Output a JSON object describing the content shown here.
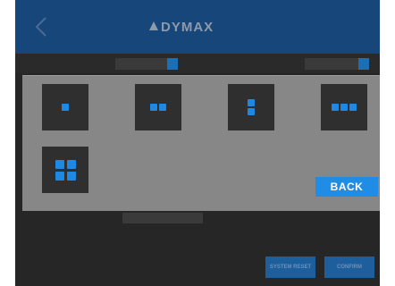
{
  "header": {
    "back_icon": "chevron-left-icon",
    "logo_text": "DYMAX",
    "info_line1": "",
    "info_line2": ""
  },
  "settings": {
    "language_label": "",
    "language_value": "",
    "units_label": "",
    "units_value": ""
  },
  "background_row": {
    "label": "",
    "value": ""
  },
  "footer": {
    "system_reset_label": "SYSTEM RESET",
    "confirm_label": "CONFIRM"
  },
  "modal": {
    "layouts": [
      {
        "id": "1",
        "dots": 1
      },
      {
        "id": "2",
        "dots": 2
      },
      {
        "id": "3",
        "dots": 2
      },
      {
        "id": "4",
        "dots": 3
      },
      {
        "id": "5",
        "dots": 4
      }
    ],
    "back_label": "BACK"
  },
  "colors": {
    "accent": "#1e88e5",
    "header": "#17467a",
    "overlay": "#878787",
    "tile": "#2f2f2f"
  }
}
